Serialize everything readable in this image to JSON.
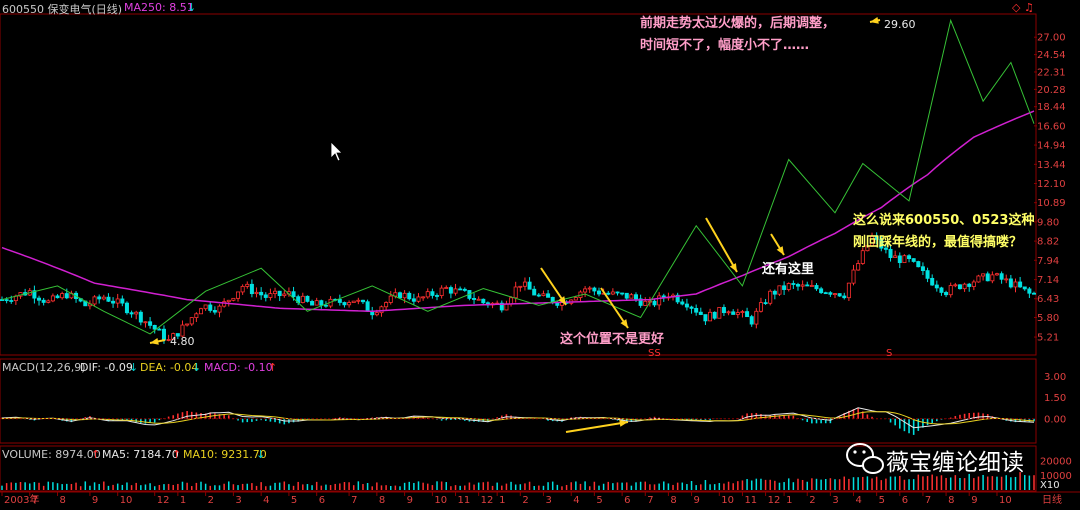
{
  "header": {
    "title": "600550 保变电气(日线)",
    "ma_label": "MA250: 8.51",
    "ma_arrow": "↓",
    "corner_icons": "◇ ♫"
  },
  "macd_header": {
    "name": "MACD(12,26,9)",
    "dif": "DIF: -0.09",
    "dif_arrow": "↓",
    "dea": "DEA: -0.04",
    "dea_arrow": "↓",
    "macd": "MACD: -0.10",
    "macd_arrow": "↑"
  },
  "volume_header": {
    "name": "VOLUME: 8974.00",
    "name_arrow": "↑",
    "ma5": "MA5: 7184.70",
    "ma5_arrow": "↑",
    "ma10": "MA10: 9231.70",
    "ma10_arrow": "↓"
  },
  "annotations": {
    "top_note_line1": "前期走势太过火爆的，后期调整，",
    "top_note_line2": "时间短不了，幅度小不了……",
    "right_note_line1": "这么说来600550、0523这种",
    "right_note_line2": "刚回踩年线的，最值得搞喽？",
    "mid_note": "这个位置不是更好",
    "also_note": "还有这里",
    "low_marker": "4.80",
    "high_marker": "29.60",
    "signal_left": "SS",
    "signal_right": "S"
  },
  "watermark": {
    "text": "薇宝缠论细读",
    "icon": "wechat-icon"
  },
  "chart_data": [
    {
      "type": "line",
      "title": "600550 保变电气(日线)",
      "scale": "log",
      "ylim": [
        4.8,
        30.0
      ],
      "y_ticks": [
        5.21,
        5.8,
        6.43,
        7.14,
        7.94,
        8.82,
        9.8,
        10.89,
        12.1,
        13.44,
        14.94,
        16.6,
        18.44,
        20.28,
        22.31,
        24.54,
        27.0
      ],
      "x_tick_labels": [
        "2003年",
        "7",
        "8",
        "9",
        "10",
        "12",
        "1",
        "2",
        "3",
        "4",
        "5",
        "6",
        "7",
        "8",
        "9",
        "10",
        "11",
        "12",
        "1",
        "2",
        "3",
        "4",
        "5",
        "6",
        "7",
        "8",
        "9",
        "10",
        "11",
        "12",
        "1",
        "2",
        "3",
        "4",
        "5",
        "6",
        "7",
        "8",
        "9",
        "10",
        "日线"
      ],
      "x_tick_index": [
        0,
        6,
        12,
        19,
        25,
        33,
        38,
        44,
        50,
        56,
        62,
        68,
        75,
        81,
        87,
        93,
        98,
        103,
        107,
        112,
        117,
        123,
        128,
        134,
        139,
        144,
        149,
        155,
        160,
        165,
        169,
        174,
        179,
        184,
        189,
        194,
        199,
        204,
        209,
        215,
        223
      ],
      "series": [
        {
          "name": "price",
          "color": "#e8e8e8",
          "x": [
            0,
            6,
            10,
            14,
            18,
            22,
            26,
            30,
            36,
            40,
            43,
            47,
            52,
            57,
            62,
            67,
            72,
            76,
            80,
            86,
            90,
            96,
            100,
            104,
            108,
            112,
            116,
            121,
            126,
            131,
            136,
            140,
            144,
            148,
            152,
            157,
            162,
            166,
            170,
            176,
            182,
            188,
            192,
            196,
            200,
            204,
            208,
            214,
            218,
            222
          ],
          "values": [
            6.4,
            6.7,
            6.3,
            6.6,
            6.2,
            6.5,
            6.2,
            5.8,
            5.1,
            5.6,
            6.2,
            6.1,
            6.9,
            6.5,
            6.6,
            6.2,
            6.3,
            6.4,
            6.0,
            6.6,
            6.4,
            6.8,
            6.6,
            6.3,
            6.2,
            7.0,
            6.5,
            6.3,
            6.8,
            6.6,
            6.5,
            6.2,
            6.6,
            6.3,
            5.8,
            6.1,
            5.7,
            6.6,
            6.9,
            6.8,
            6.6,
            9.0,
            8.1,
            7.9,
            7.2,
            6.7,
            7.0,
            7.3,
            7.0,
            6.6
          ]
        },
        {
          "name": "MA250",
          "color": "#d020d0",
          "x": [
            0,
            20,
            40,
            60,
            80,
            100,
            120,
            140,
            150,
            160,
            170,
            180,
            190,
            200,
            210,
            223
          ],
          "values": [
            8.51,
            7.0,
            6.4,
            6.1,
            6.0,
            6.2,
            6.3,
            6.4,
            6.6,
            7.3,
            8.1,
            9.2,
            10.6,
            12.7,
            15.6,
            18.0
          ]
        }
      ],
      "segments": {
        "color": "#36c236",
        "x": [
          0,
          12,
          22,
          32,
          44,
          56,
          66,
          80,
          92,
          104,
          116,
          126,
          138,
          150,
          160,
          170,
          180,
          186,
          196,
          205,
          212,
          218,
          223
        ],
        "values": [
          6.4,
          6.9,
          6.0,
          5.3,
          6.7,
          7.6,
          6.0,
          6.9,
          6.0,
          6.8,
          6.2,
          6.6,
          5.8,
          9.6,
          6.9,
          13.8,
          10.3,
          13.5,
          11.0,
          29.6,
          19.0,
          23.5,
          16.8
        ]
      }
    },
    {
      "type": "bar",
      "title": "MACD(12,26,9)",
      "ylim": [
        -1.5,
        3.3
      ],
      "y_ticks": [
        0.0,
        1.5,
        3.0
      ],
      "series": [
        {
          "name": "DIF",
          "values": [
            -0.09
          ]
        },
        {
          "name": "DEA",
          "values": [
            -0.04
          ]
        },
        {
          "name": "MACD",
          "values": [
            -0.1
          ]
        }
      ]
    },
    {
      "type": "bar",
      "title": "VOLUME",
      "y_ticks": [
        10000,
        20000
      ],
      "series": [
        {
          "name": "VOLUME",
          "values": [
            8974.0
          ]
        },
        {
          "name": "MA5",
          "values": [
            7184.7
          ]
        },
        {
          "name": "MA10",
          "values": [
            9231.7
          ]
        }
      ],
      "y_unit_label": "X10"
    }
  ]
}
